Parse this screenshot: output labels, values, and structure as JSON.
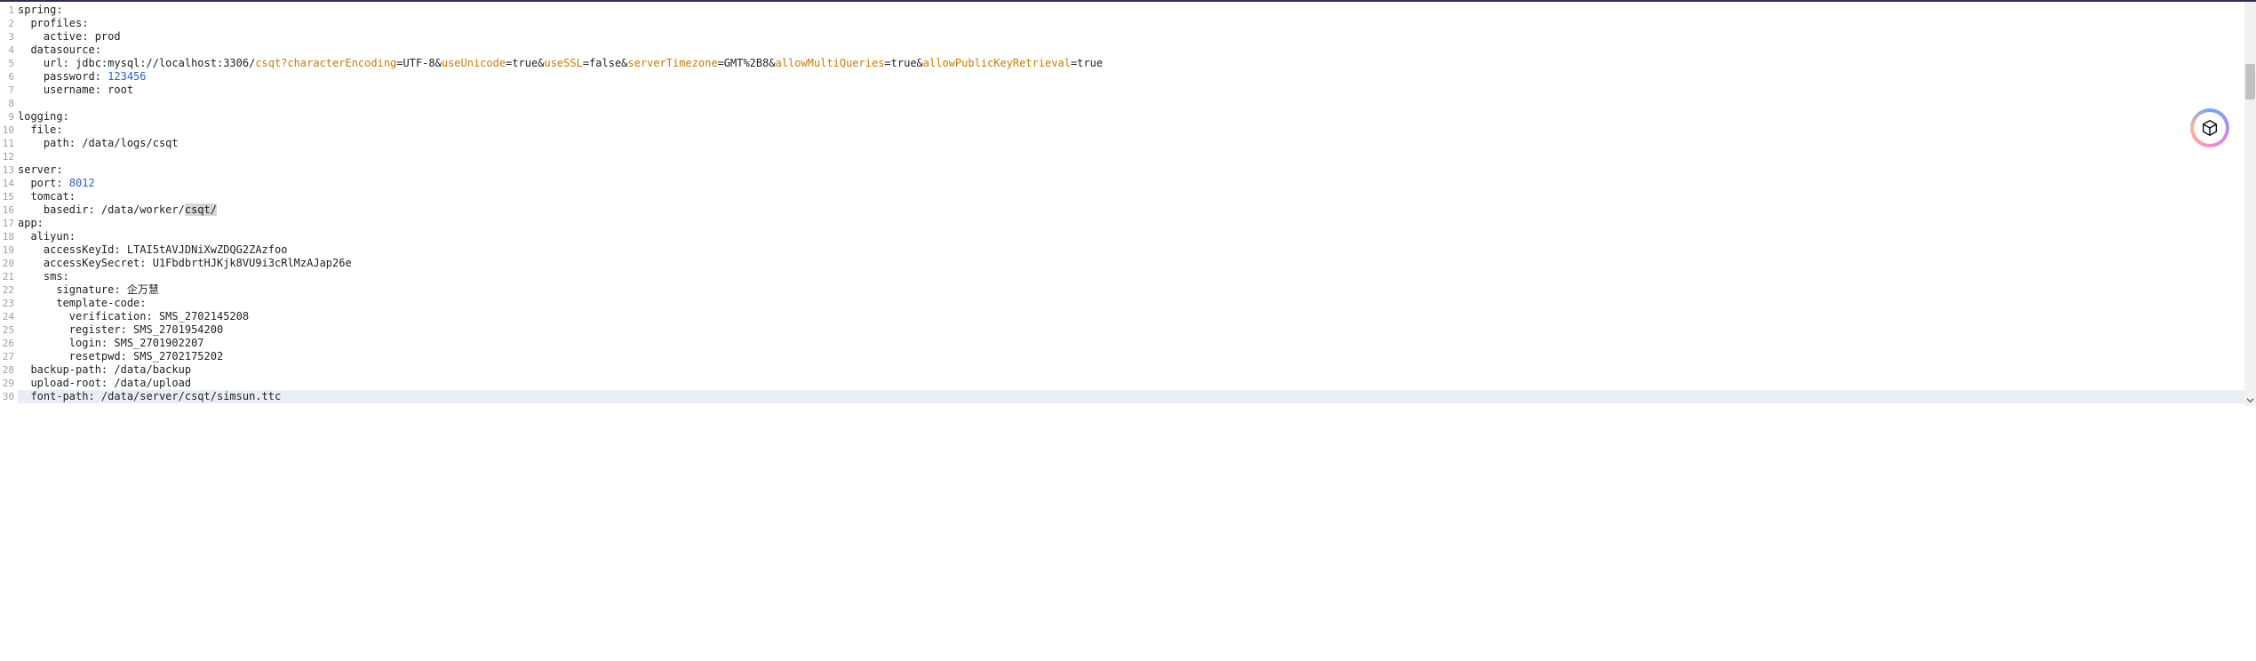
{
  "editor": {
    "line_count": 30,
    "current_line": 30,
    "lines": [
      {
        "n": 1,
        "indent": 0,
        "segments": [
          {
            "t": "spring:"
          }
        ]
      },
      {
        "n": 2,
        "indent": 1,
        "segments": [
          {
            "t": "profiles:"
          }
        ]
      },
      {
        "n": 3,
        "indent": 2,
        "segments": [
          {
            "t": "active: prod"
          }
        ]
      },
      {
        "n": 4,
        "indent": 1,
        "segments": [
          {
            "t": "datasource:"
          }
        ]
      },
      {
        "n": 5,
        "indent": 2,
        "segments": [
          {
            "t": "url: jdbc:mysql://localhost:3306/"
          },
          {
            "t": "csqt?characterEncoding",
            "cls": "tok-orange"
          },
          {
            "t": "=UTF-8&"
          },
          {
            "t": "useUnicode",
            "cls": "tok-orange"
          },
          {
            "t": "=true&"
          },
          {
            "t": "useSSL",
            "cls": "tok-orange"
          },
          {
            "t": "=false&"
          },
          {
            "t": "serverTimezone",
            "cls": "tok-orange"
          },
          {
            "t": "=GMT%2B8&"
          },
          {
            "t": "allowMultiQueries",
            "cls": "tok-orange"
          },
          {
            "t": "=true&"
          },
          {
            "t": "allowPublicKeyRetrieval",
            "cls": "tok-orange"
          },
          {
            "t": "=true"
          }
        ]
      },
      {
        "n": 6,
        "indent": 2,
        "segments": [
          {
            "t": "password: "
          },
          {
            "t": "123456",
            "cls": "tok-num"
          }
        ]
      },
      {
        "n": 7,
        "indent": 2,
        "segments": [
          {
            "t": "username: root"
          }
        ]
      },
      {
        "n": 8,
        "indent": 0,
        "segments": [
          {
            "t": ""
          }
        ]
      },
      {
        "n": 9,
        "indent": 0,
        "segments": [
          {
            "t": "logging:"
          }
        ]
      },
      {
        "n": 10,
        "indent": 1,
        "segments": [
          {
            "t": "file:"
          }
        ]
      },
      {
        "n": 11,
        "indent": 2,
        "segments": [
          {
            "t": "path: /data/logs/csqt"
          }
        ]
      },
      {
        "n": 12,
        "indent": 0,
        "segments": [
          {
            "t": ""
          }
        ]
      },
      {
        "n": 13,
        "indent": 0,
        "segments": [
          {
            "t": "server:"
          }
        ]
      },
      {
        "n": 14,
        "indent": 1,
        "segments": [
          {
            "t": "port: "
          },
          {
            "t": "8012",
            "cls": "tok-num"
          }
        ]
      },
      {
        "n": 15,
        "indent": 1,
        "segments": [
          {
            "t": "tomcat:"
          }
        ]
      },
      {
        "n": 16,
        "indent": 2,
        "segments": [
          {
            "t": "basedir: /data/worker/"
          },
          {
            "t": "csqt/",
            "cls": "highlight"
          }
        ]
      },
      {
        "n": 17,
        "indent": 0,
        "segments": [
          {
            "t": "app:"
          }
        ]
      },
      {
        "n": 18,
        "indent": 1,
        "segments": [
          {
            "t": "aliyun:"
          }
        ]
      },
      {
        "n": 19,
        "indent": 2,
        "segments": [
          {
            "t": "accessKeyId: LTAI5tAVJDNiXwZDQG2ZAzfoo"
          }
        ]
      },
      {
        "n": 20,
        "indent": 2,
        "segments": [
          {
            "t": "accessKeySecret: U1FbdbrtHJKjk8VU9i3cRlMzAJap26e"
          }
        ]
      },
      {
        "n": 21,
        "indent": 2,
        "segments": [
          {
            "t": "sms:"
          }
        ]
      },
      {
        "n": 22,
        "indent": 3,
        "segments": [
          {
            "t": "signature: 企万慧"
          }
        ]
      },
      {
        "n": 23,
        "indent": 3,
        "segments": [
          {
            "t": "template-code:"
          }
        ]
      },
      {
        "n": 24,
        "indent": 4,
        "segments": [
          {
            "t": "verification: SMS_2702145208"
          }
        ]
      },
      {
        "n": 25,
        "indent": 4,
        "segments": [
          {
            "t": "register: SMS_2701954200"
          }
        ]
      },
      {
        "n": 26,
        "indent": 4,
        "segments": [
          {
            "t": "login: SMS_2701902207"
          }
        ]
      },
      {
        "n": 27,
        "indent": 4,
        "segments": [
          {
            "t": "resetpwd: SMS_2702175202"
          }
        ]
      },
      {
        "n": 28,
        "indent": 1,
        "segments": [
          {
            "t": "backup-path: /data/backup"
          }
        ]
      },
      {
        "n": 29,
        "indent": 1,
        "segments": [
          {
            "t": "upload-root: /data/upload"
          }
        ]
      },
      {
        "n": 30,
        "indent": 1,
        "segments": [
          {
            "t": "font-path: /data/server/csqt/simsun.ttc"
          }
        ]
      }
    ]
  },
  "logo": {
    "name": "yupaopao-logo"
  }
}
